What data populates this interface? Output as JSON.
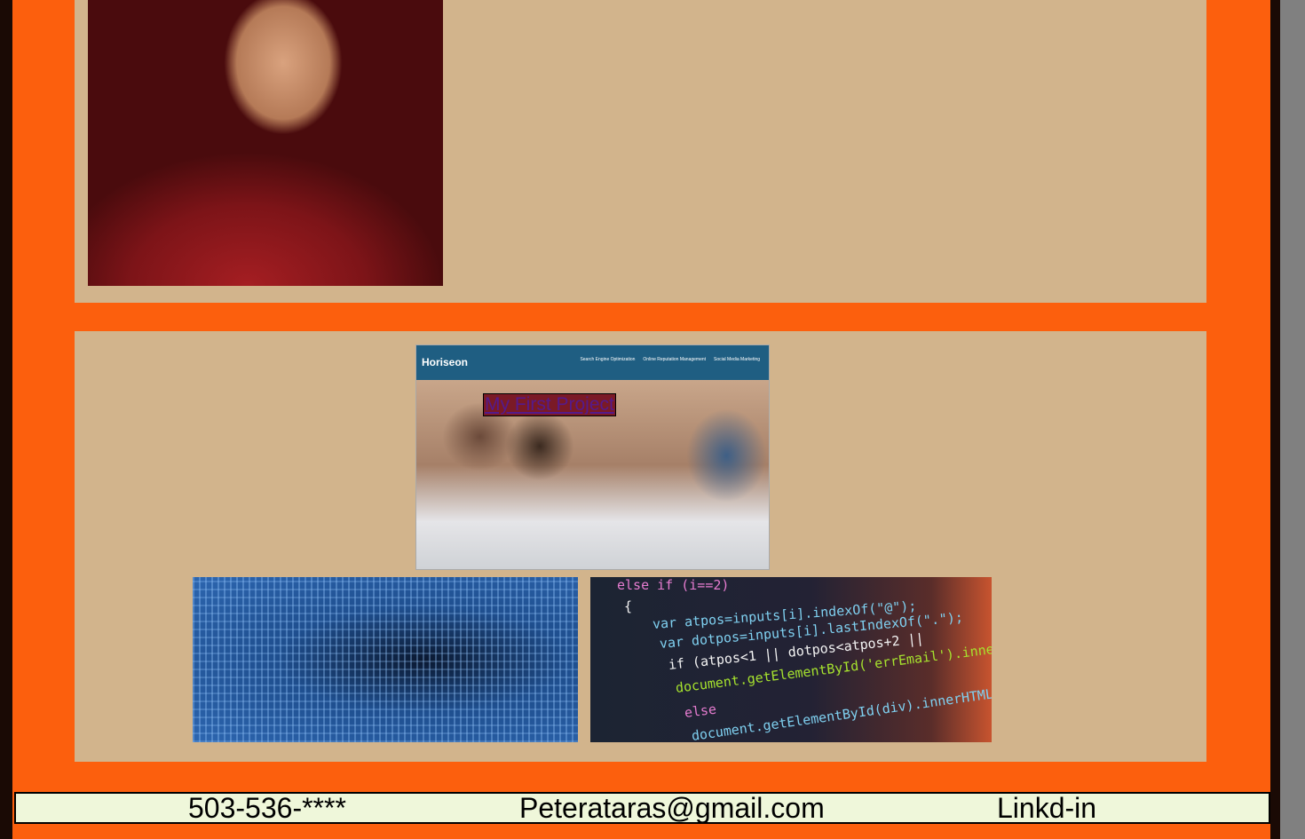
{
  "about": {
    "photo_icon": "profile-photo"
  },
  "projects": {
    "first": {
      "title": "My First Project",
      "screenshot": {
        "brand": "Horiseon",
        "nav": [
          "Search Engine Optimization",
          "Online Reputation Management",
          "Social Media Marketing"
        ]
      }
    },
    "second": {
      "image": "binary-data-image"
    },
    "third": {
      "image": "code-screen-image",
      "code_lines": [
        "else if (i==2)",
        "{",
        "var atpos=inputs[i].indexOf(\"@\");",
        "var dotpos=inputs[i].lastIndexOf(\".\");",
        "if (atpos<1 || dotpos<atpos+2 ||",
        "document.getElementById('errEmail').innerHTML = \"*\";",
        "else",
        "document.getElementById(div).innerHTML = \"\";"
      ]
    }
  },
  "footer": {
    "phone": "503-536-****",
    "email": "Peterataras@gmail.com",
    "link": "Linkd-in"
  },
  "colors": {
    "page_bg": "#fc5f0d",
    "panel_bg": "#d2b48c",
    "footer_bg": "#eff7da",
    "link_color": "#551a8b"
  }
}
